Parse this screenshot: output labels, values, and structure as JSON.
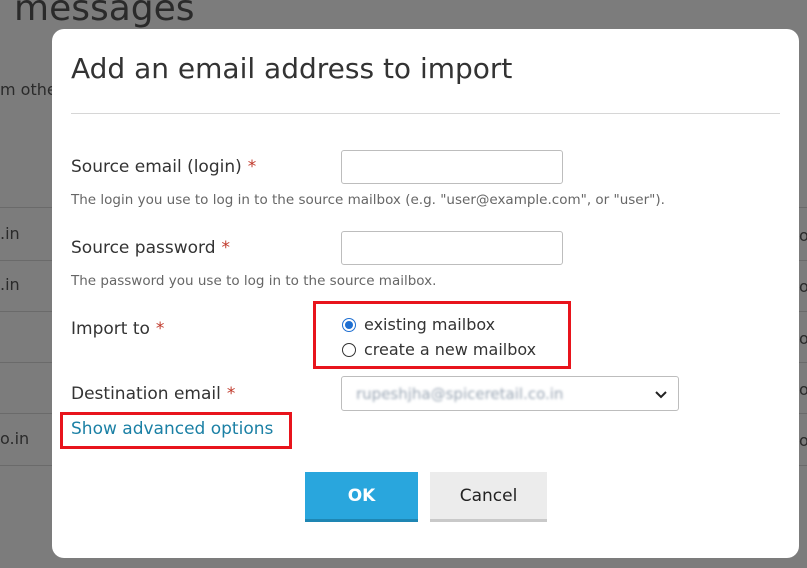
{
  "background": {
    "page_title": "messages",
    "subtext": "m othe",
    "rows_left": [
      ".in",
      ".in",
      "o.in"
    ],
    "rows_right": [
      "o",
      "o",
      "o",
      "o",
      "o"
    ]
  },
  "modal": {
    "title": "Add an email address to import",
    "source_email": {
      "label": "Source email (login)",
      "required": "*",
      "value": "",
      "help": "The login you use to log in to the source mailbox (e.g. \"user@example.com\", or \"user\")."
    },
    "source_password": {
      "label": "Source password",
      "required": "*",
      "value": "",
      "help": "The password you use to log in to the source mailbox."
    },
    "import_to": {
      "label": "Import to",
      "required": "*",
      "options": [
        {
          "label": "existing mailbox",
          "selected": true
        },
        {
          "label": "create a new mailbox",
          "selected": false
        }
      ]
    },
    "destination_email": {
      "label": "Destination email",
      "required": "*",
      "value": "rupeshjha@spiceretail.co.in"
    },
    "advanced_link": "Show advanced options",
    "ok_label": "OK",
    "cancel_label": "Cancel"
  },
  "colors": {
    "primary_button": "#29a6dd",
    "link": "#1b80a5",
    "required": "#c0392b",
    "highlight_box": "#e8141c"
  },
  "icons": {
    "select_arrow": "chevron-down-icon"
  }
}
